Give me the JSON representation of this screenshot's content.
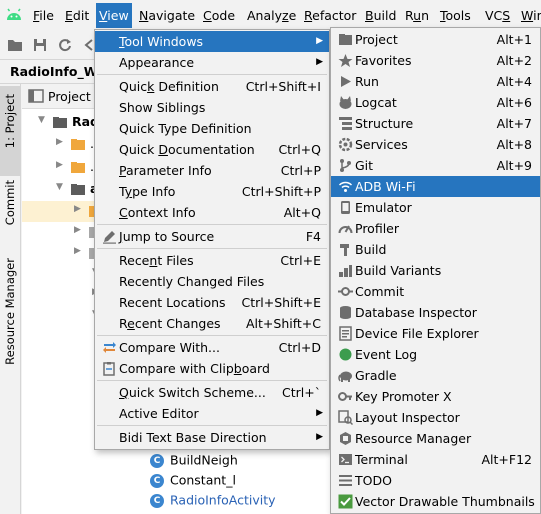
{
  "menubar": {
    "items": [
      {
        "label": "File",
        "mn": "F"
      },
      {
        "label": "Edit",
        "mn": "E"
      },
      {
        "label": "View",
        "mn": "V"
      },
      {
        "label": "Navigate",
        "mn": "N"
      },
      {
        "label": "Code",
        "mn": "C"
      },
      {
        "label": "Analyze",
        "mn": "z"
      },
      {
        "label": "Refactor",
        "mn": "R"
      },
      {
        "label": "Build",
        "mn": "B"
      },
      {
        "label": "Run",
        "mn": "u"
      },
      {
        "label": "Tools",
        "mn": "T"
      },
      {
        "label": "VCS",
        "mn": "S"
      },
      {
        "label": "Win",
        "mn": "W"
      }
    ]
  },
  "breadcrumb": {
    "project": "RadioInfo_Wa"
  },
  "stripe": {
    "project": "1: Project",
    "commit": "Commit",
    "resource_manager": "Resource Manager"
  },
  "panel": {
    "title": "Project",
    "tree": [
      {
        "text": "Radio",
        "icon": "folder-icon",
        "indent": 2,
        "expanded": true,
        "bold": true
      },
      {
        "text": ".gr",
        "icon": "folder-icon",
        "indent": 3,
        "expanded": false,
        "bold": false
      },
      {
        "text": ".ide",
        "icon": "folder-icon",
        "indent": 3,
        "expanded": false,
        "bold": false
      },
      {
        "text": "ap",
        "icon": "module-folder-icon",
        "indent": 3,
        "expanded": true,
        "bold": true
      },
      {
        "text": "",
        "icon": "folder-icon",
        "indent": 4,
        "expanded": false,
        "bold": false
      },
      {
        "text": "",
        "icon": "folder-icon",
        "indent": 4,
        "expanded": false,
        "bold": false
      },
      {
        "text": "",
        "icon": "folder-icon",
        "indent": 4,
        "expanded": false,
        "bold": false
      },
      {
        "text": "",
        "icon": "folder-icon",
        "indent": 5,
        "expanded": true,
        "bold": false
      },
      {
        "text": "",
        "icon": "folder-icon",
        "indent": 5,
        "expanded": false,
        "bold": false
      },
      {
        "text": "",
        "icon": "folder-icon",
        "indent": 5,
        "expanded": true,
        "bold": false
      }
    ],
    "classes": [
      "BuildNeigh",
      "Constant_l",
      "RadioInfoActivity"
    ]
  },
  "view_menu": {
    "items": [
      {
        "label": "Tool Windows",
        "mn": "T",
        "shortcut": "",
        "submenu": true,
        "highlight": true,
        "icon": ""
      },
      {
        "label": "Appearance",
        "mn": "",
        "shortcut": "",
        "submenu": true,
        "highlight": false,
        "icon": ""
      },
      {
        "sep": true
      },
      {
        "label": "Quick Definition",
        "mn": "k",
        "shortcut": "Ctrl+Shift+I",
        "icon": ""
      },
      {
        "label": "Show Siblings",
        "mn": "",
        "shortcut": "",
        "icon": ""
      },
      {
        "label": "Quick Type Definition",
        "mn": "",
        "shortcut": "",
        "icon": ""
      },
      {
        "label": "Quick Documentation",
        "mn": "D",
        "shortcut": "Ctrl+Q",
        "icon": ""
      },
      {
        "label": "Parameter Info",
        "mn": "P",
        "shortcut": "Ctrl+P",
        "icon": ""
      },
      {
        "label": "Type Info",
        "mn": "y",
        "shortcut": "Ctrl+Shift+P",
        "icon": ""
      },
      {
        "label": "Context Info",
        "mn": "C",
        "shortcut": "Alt+Q",
        "icon": ""
      },
      {
        "sep": true
      },
      {
        "label": "Jump to Source",
        "mn": "J",
        "shortcut": "F4",
        "icon": "edit-pencil-icon"
      },
      {
        "sep": true
      },
      {
        "label": "Recent Files",
        "mn": "n",
        "shortcut": "Ctrl+E",
        "icon": ""
      },
      {
        "label": "Recently Changed Files",
        "mn": "",
        "shortcut": "",
        "icon": ""
      },
      {
        "label": "Recent Locations",
        "mn": "",
        "shortcut": "Ctrl+Shift+E",
        "icon": ""
      },
      {
        "label": "Recent Changes",
        "mn": "e",
        "shortcut": "Alt+Shift+C",
        "icon": ""
      },
      {
        "sep": true
      },
      {
        "label": "Compare With...",
        "mn": "",
        "shortcut": "Ctrl+D",
        "icon": "compare-arrows-icon"
      },
      {
        "label": "Compare with Clipboard",
        "mn": "b",
        "shortcut": "",
        "icon": "compare-clipboard-icon"
      },
      {
        "sep": true
      },
      {
        "label": "Quick Switch Scheme...",
        "mn": "Q",
        "shortcut": "Ctrl+`",
        "icon": ""
      },
      {
        "label": "Active Editor",
        "mn": "",
        "shortcut": "",
        "submenu": true,
        "icon": ""
      },
      {
        "sep": true
      },
      {
        "label": "Bidi Text Base Direction",
        "mn": "",
        "shortcut": "",
        "submenu": true,
        "icon": ""
      }
    ]
  },
  "tool_windows_menu": {
    "items": [
      {
        "label": "Project",
        "shortcut": "Alt+1",
        "icon": "project-folder-icon"
      },
      {
        "label": "Favorites",
        "shortcut": "Alt+2",
        "icon": "star-icon"
      },
      {
        "label": "Run",
        "shortcut": "Alt+4",
        "icon": "run-icon"
      },
      {
        "label": "Logcat",
        "shortcut": "Alt+6",
        "icon": "logcat-icon"
      },
      {
        "label": "Structure",
        "shortcut": "Alt+7",
        "icon": "structure-icon"
      },
      {
        "label": "Services",
        "shortcut": "Alt+8",
        "icon": "services-icon"
      },
      {
        "label": "Git",
        "shortcut": "Alt+9",
        "icon": "git-branch-icon"
      },
      {
        "label": "ADB Wi-Fi",
        "shortcut": "",
        "icon": "wifi-icon",
        "highlight": true
      },
      {
        "label": "Emulator",
        "shortcut": "",
        "icon": "emulator-icon"
      },
      {
        "label": "Profiler",
        "shortcut": "",
        "icon": "profiler-gauge-icon"
      },
      {
        "label": "Build",
        "shortcut": "",
        "icon": "build-hammer-icon"
      },
      {
        "label": "Build Variants",
        "shortcut": "",
        "icon": "build-variants-icon"
      },
      {
        "label": "Commit",
        "shortcut": "",
        "icon": "commit-icon"
      },
      {
        "label": "Database Inspector",
        "shortcut": "",
        "icon": "database-icon"
      },
      {
        "label": "Device File Explorer",
        "shortcut": "",
        "icon": "device-file-icon"
      },
      {
        "label": "Event Log",
        "shortcut": "",
        "icon": "event-log-icon"
      },
      {
        "label": "Gradle",
        "shortcut": "",
        "icon": "gradle-elephant-icon"
      },
      {
        "label": "Key Promoter X",
        "shortcut": "",
        "icon": "key-icon"
      },
      {
        "label": "Layout Inspector",
        "shortcut": "",
        "icon": "layout-inspector-icon"
      },
      {
        "label": "Resource Manager",
        "shortcut": "",
        "icon": "resource-manager-icon"
      },
      {
        "label": "Terminal",
        "shortcut": "Alt+F12",
        "icon": "terminal-icon"
      },
      {
        "label": "TODO",
        "shortcut": "",
        "icon": "todo-list-icon"
      },
      {
        "label": "Vector Drawable Thumbnails",
        "shortcut": "",
        "icon": "checkmark-icon"
      }
    ]
  }
}
